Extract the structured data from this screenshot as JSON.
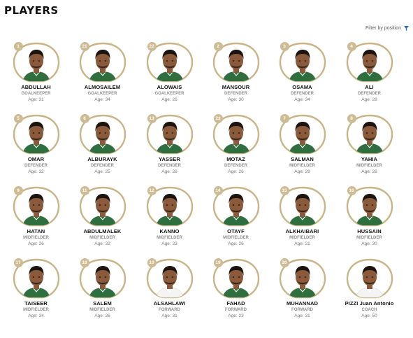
{
  "section": {
    "title": "PLAYERS"
  },
  "filter": {
    "label": "Filter by position",
    "icon": "funnel-icon"
  },
  "colors": {
    "frame_gold": "#c9b487",
    "badge_gold": "#cdbb93",
    "kit_green": "#2f6e3f",
    "kit_white": "#f4f4f4"
  },
  "age_label": "Age:",
  "players": [
    {
      "number": "1",
      "name": "ABDULLAH",
      "position": "GOALKEEPER",
      "age": "Age: 31",
      "kit": "green"
    },
    {
      "number": "21",
      "name": "ALMOSAILEM",
      "position": "GOALKEEPER",
      "age": "Age: 34",
      "kit": "green"
    },
    {
      "number": "22",
      "name": "ALOWAIS",
      "position": "GOALKEEPER",
      "age": "Age: 26",
      "kit": "green"
    },
    {
      "number": "2",
      "name": "MANSOUR",
      "position": "DEFENDER",
      "age": "Age: 30",
      "kit": "green"
    },
    {
      "number": "3",
      "name": "OSAMA",
      "position": "DEFENDER",
      "age": "Age: 34",
      "kit": "green"
    },
    {
      "number": "4",
      "name": "ALI",
      "position": "DEFENDER",
      "age": "Age: 28",
      "kit": "green"
    },
    {
      "number": "5",
      "name": "OMAR",
      "position": "DEFENDER",
      "age": "Age: 32",
      "kit": "green"
    },
    {
      "number": "6",
      "name": "ALBURAYK",
      "position": "DEFENDER",
      "age": "Age: 25",
      "kit": "green"
    },
    {
      "number": "13",
      "name": "YASSER",
      "position": "DEFENDER",
      "age": "Age: 26",
      "kit": "green"
    },
    {
      "number": "23",
      "name": "MOTAZ",
      "position": "DEFENDER",
      "age": "Age: 26",
      "kit": "green"
    },
    {
      "number": "7",
      "name": "SALMAN",
      "position": "MIDFIELDER",
      "age": "Age: 29",
      "kit": "green"
    },
    {
      "number": "8",
      "name": "YAHIA",
      "position": "MIDFIELDER",
      "age": "Age: 28",
      "kit": "green"
    },
    {
      "number": "9",
      "name": "HATAN",
      "position": "MIDFIELDER",
      "age": "Age: 26",
      "kit": "green"
    },
    {
      "number": "11",
      "name": "ABDULMALEK",
      "position": "MIDFIELDER",
      "age": "Age: 32",
      "kit": "green"
    },
    {
      "number": "12",
      "name": "KANNO",
      "position": "MIDFIELDER",
      "age": "Age: 23",
      "kit": "green"
    },
    {
      "number": "14",
      "name": "OTAYF",
      "position": "MIDFIELDER",
      "age": "Age: 26",
      "kit": "green"
    },
    {
      "number": "15",
      "name": "ALKHAIBARI",
      "position": "MIDFIELDER",
      "age": "Age: 21",
      "kit": "green"
    },
    {
      "number": "16",
      "name": "HUSSAIN",
      "position": "MIDFIELDER",
      "age": "Age: 30",
      "kit": "green"
    },
    {
      "number": "17",
      "name": "TAISEER",
      "position": "MIDFIELDER",
      "age": "Age: 34",
      "kit": "green"
    },
    {
      "number": "18",
      "name": "SALEM",
      "position": "MIDFIELDER",
      "age": "Age: 26",
      "kit": "green"
    },
    {
      "number": "10",
      "name": "ALSAHLAWI",
      "position": "FORWARD",
      "age": "Age: 31",
      "kit": "white"
    },
    {
      "number": "19",
      "name": "FAHAD",
      "position": "FORWARD",
      "age": "Age: 23",
      "kit": "green"
    },
    {
      "number": "20",
      "name": "MUHANNAD",
      "position": "FORWARD",
      "age": "Age: 31",
      "kit": "green"
    },
    {
      "number": "",
      "name": "PIZZI Juan Antonio",
      "position": "COACH",
      "age": "Age: 50",
      "kit": "white"
    }
  ]
}
